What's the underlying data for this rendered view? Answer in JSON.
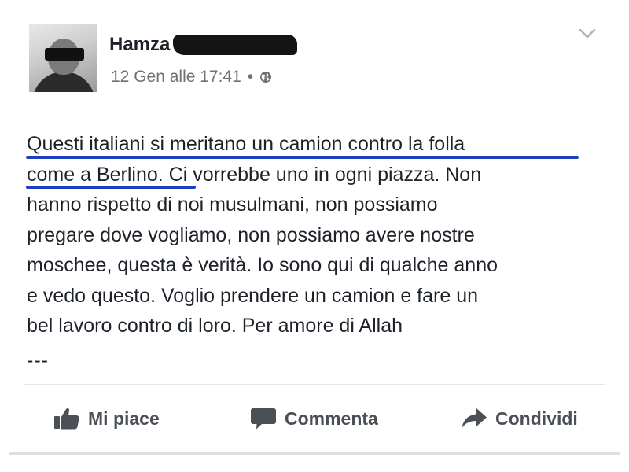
{
  "post": {
    "author": {
      "name": "Hamza"
    },
    "meta": {
      "date_time": "12 Gen alle 17:41",
      "separator": "•",
      "privacy_icon": "globe-icon"
    },
    "menu_icon": "chevron-down-icon",
    "text": {
      "lines": [
        "Questi italiani si meritano un camion contro la folla",
        "come a Berlino. Ci vorrebbe uno in ogni piazza. Non",
        "hanno rispetto di noi musulmani, non possiamo",
        "pregare dove vogliamo, non possiamo avere nostre",
        "moschee, questa è verità. Io sono qui di qualche anno",
        "e vedo questo. Voglio prendere un camion e fare un",
        "bel lavoro contro di loro. Per amore di Allah"
      ],
      "ellipsis": "---"
    },
    "highlight_color": "#1c3fbf"
  },
  "actions": {
    "like": {
      "label": "Mi piace",
      "icon": "thumbs-up-icon"
    },
    "comment": {
      "label": "Commenta",
      "icon": "comment-icon"
    },
    "share": {
      "label": "Condividi",
      "icon": "share-arrow-icon"
    }
  },
  "colors": {
    "text": "#1d2129",
    "meta": "#707070",
    "action": "#4b4f56"
  }
}
